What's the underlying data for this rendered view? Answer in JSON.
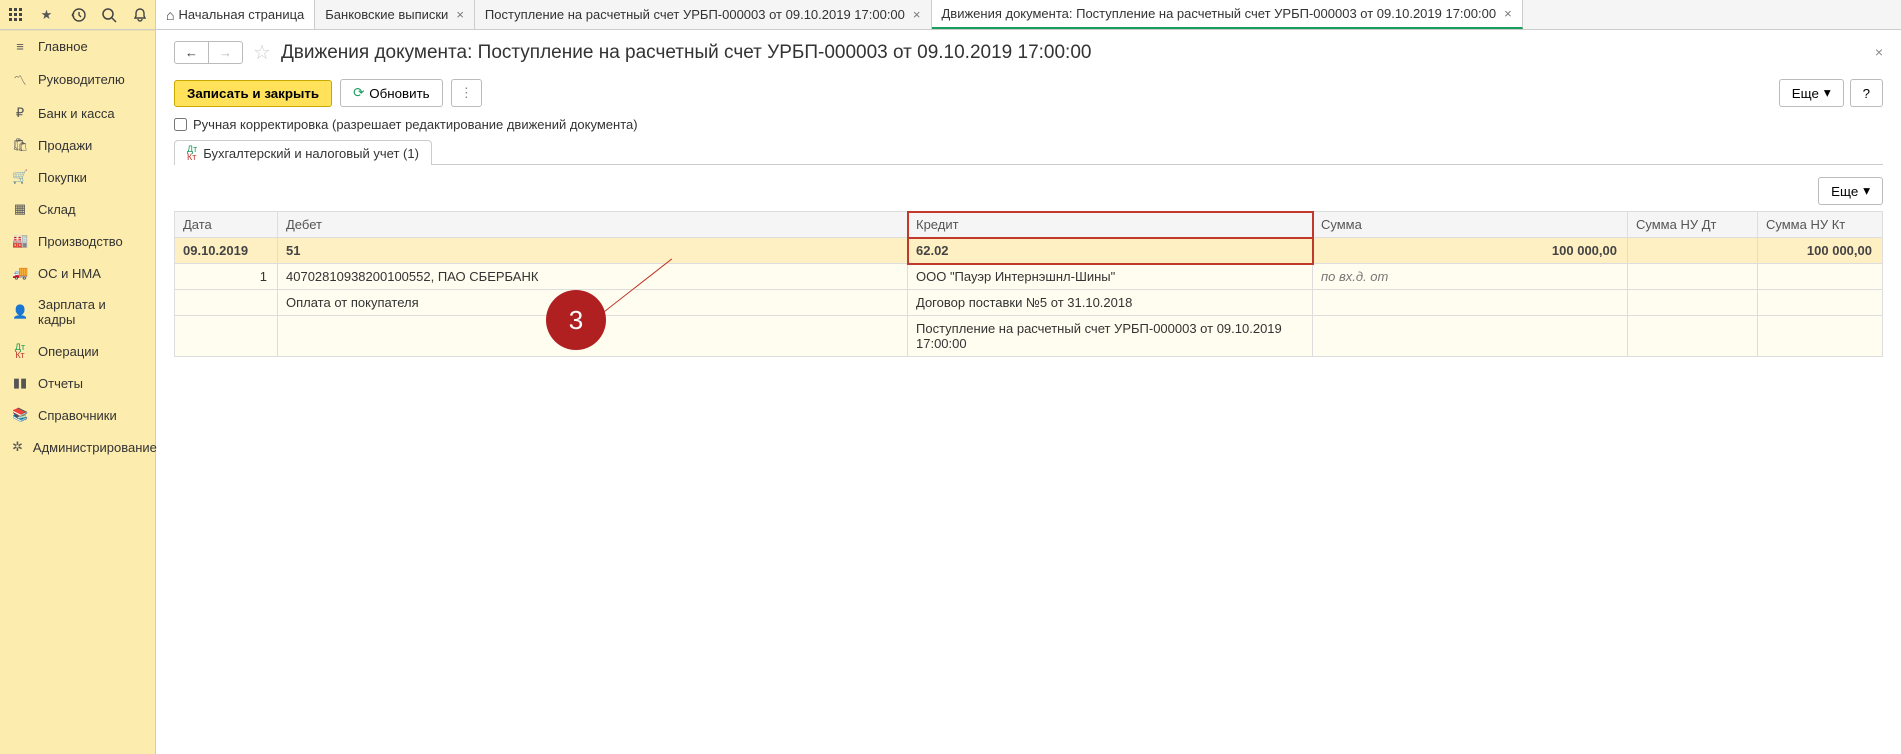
{
  "top_icons": [
    "apps-icon",
    "star-icon",
    "history-icon",
    "search-icon",
    "bell-icon"
  ],
  "tabs": [
    {
      "label": "Начальная страница",
      "home": true
    },
    {
      "label": "Банковские выписки",
      "close": true
    },
    {
      "label": "Поступление на расчетный счет УРБП-000003 от 09.10.2019 17:00:00",
      "close": true
    },
    {
      "label": "Движения документа: Поступление на расчетный счет УРБП-000003 от 09.10.2019 17:00:00",
      "close": true,
      "active": true
    }
  ],
  "sidebar": [
    {
      "icon": "menu-icon",
      "label": "Главное"
    },
    {
      "icon": "chart-up-icon",
      "label": "Руководителю"
    },
    {
      "icon": "ruble-icon",
      "label": "Банк и касса"
    },
    {
      "icon": "bag-icon",
      "label": "Продажи"
    },
    {
      "icon": "cart-icon",
      "label": "Покупки"
    },
    {
      "icon": "boxes-icon",
      "label": "Склад"
    },
    {
      "icon": "factory-icon",
      "label": "Производство"
    },
    {
      "icon": "truck-icon",
      "label": "ОС и НМА"
    },
    {
      "icon": "person-icon",
      "label": "Зарплата и кадры"
    },
    {
      "icon": "dtkt-icon",
      "label": "Операции"
    },
    {
      "icon": "bar-chart-icon",
      "label": "Отчеты"
    },
    {
      "icon": "book-icon",
      "label": "Справочники"
    },
    {
      "icon": "gear-icon",
      "label": "Администрирование"
    }
  ],
  "page": {
    "title": "Движения документа: Поступление на расчетный счет УРБП-000003 от 09.10.2019 17:00:00",
    "btn_save": "Записать и закрыть",
    "btn_refresh": "Обновить",
    "btn_more": "Еще",
    "btn_help": "?",
    "chk_label": "Ручная корректировка (разрешает редактирование движений документа)",
    "sub_tab": "Бухгалтерский и налоговый учет (1)"
  },
  "table": {
    "headers": {
      "date": "Дата",
      "debit": "Дебет",
      "credit": "Кредит",
      "sum": "Сумма",
      "nudt": "Сумма НУ Дт",
      "nukt": "Сумма НУ Кт"
    },
    "row1": {
      "date": "09.10.2019",
      "debit": "51",
      "credit": "62.02",
      "sum": "100 000,00",
      "nukt": "100 000,00"
    },
    "row2": {
      "n": "1",
      "debit": "40702810938200100552, ПАО СБЕРБАНК",
      "credit": "ООО \"Пауэр Интернэшнл-Шины\"",
      "sum": "по вх.д.  от"
    },
    "row3": {
      "debit": "Оплата от покупателя",
      "credit": "Договор поставки №5 от 31.10.2018"
    },
    "row4": {
      "credit": "Поступление на расчетный счет УРБП-000003 от 09.10.2019 17:00:00"
    }
  },
  "callout": {
    "number": "3"
  }
}
